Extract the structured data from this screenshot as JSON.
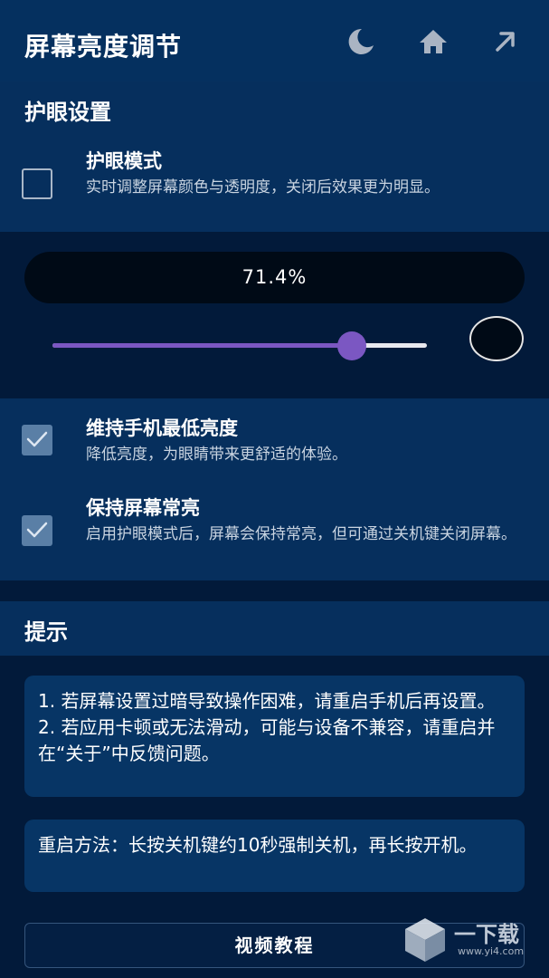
{
  "appbar": {
    "title": "屏幕亮度调节",
    "icons": [
      "moon-icon",
      "home-icon",
      "arrow-up-right-icon"
    ]
  },
  "eye_protection": {
    "heading": "护眼设置",
    "mode": {
      "title": "护眼模式",
      "description": "实时调整屏幕颜色与透明度，关闭后效果更为明显。",
      "checked": false
    }
  },
  "brightness": {
    "value_label": "71.4%",
    "slider_fraction": 0.8,
    "preview_color": "#000a16",
    "accent_color": "#7b57c2"
  },
  "options": [
    {
      "title": "维持手机最低亮度",
      "description": "降低亮度，为眼睛带来更舒适的体验。",
      "checked": true
    },
    {
      "title": "保持屏幕常亮",
      "description": "启用护眼模式后，屏幕会保持常亮，但可通过关机键关闭屏幕。",
      "checked": true
    }
  ],
  "tips": {
    "heading": "提示",
    "box1": [
      "1. 若屏幕设置过暗导致操作困难，请重启手机后再设置。",
      "2. 若应用卡顿或无法滑动，可能与设备不兼容，请重启并在“关于”中反馈问题。"
    ],
    "box2": "重启方法：长按关机键约10秒强制关机，再长按开机。",
    "video_button": "视频教程"
  },
  "watermark": {
    "text": "一下载",
    "url": "www.yi4.com"
  }
}
